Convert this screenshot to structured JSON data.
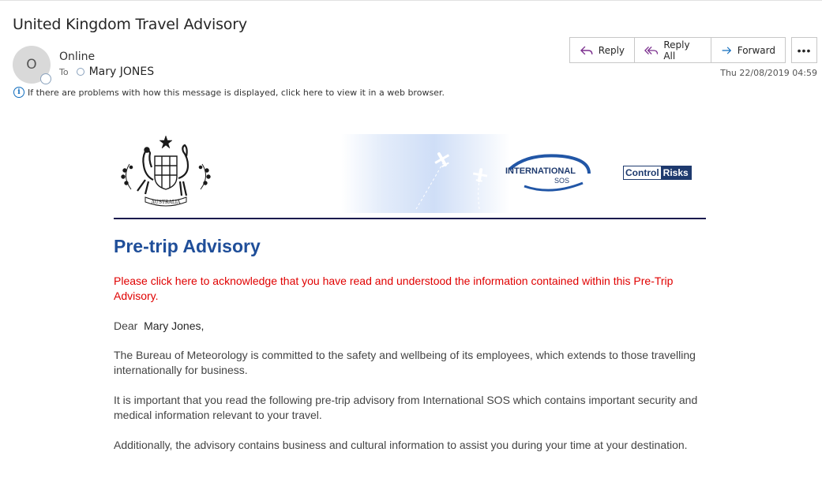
{
  "subject": "United Kingdom Travel Advisory",
  "avatar_initial": "O",
  "sender": "Online",
  "recipient": {
    "label": "To",
    "name": "Mary JONES"
  },
  "info_bar": "If there are problems with how this message is displayed, click here to view it in a web browser.",
  "actions": {
    "reply": "Reply",
    "reply_all": "Reply All",
    "forward": "Forward",
    "more": "•••"
  },
  "date": "Thu 22/08/2019 04:59",
  "banner": {
    "isos_line1": "INTERNATIONAL",
    "isos_line2": "SOS",
    "cr_part1": "Control",
    "cr_part2": "Risks",
    "crest_text": "AUSTRALIA"
  },
  "body": {
    "headline": "Pre-trip Advisory",
    "ack": "Please click here to acknowledge that you have read and understood the information contained within this Pre-Trip Advisory.",
    "greeting": "Dear",
    "greeting_name": "Mary Jones,",
    "p1": "The Bureau of Meteorology is committed to the safety and wellbeing of its employees, which extends to those travelling internationally for business.",
    "p2": "It is important that you read the following pre-trip advisory from International SOS which contains important security and medical information relevant to your travel.",
    "p3": "Additionally, the advisory contains business and cultural information to assist you during your time at your destination."
  },
  "colors": {
    "accent": "#0f6cbd",
    "headline": "#1f4e99",
    "alert": "#e00000",
    "brand_navy": "#1e3a6e"
  }
}
